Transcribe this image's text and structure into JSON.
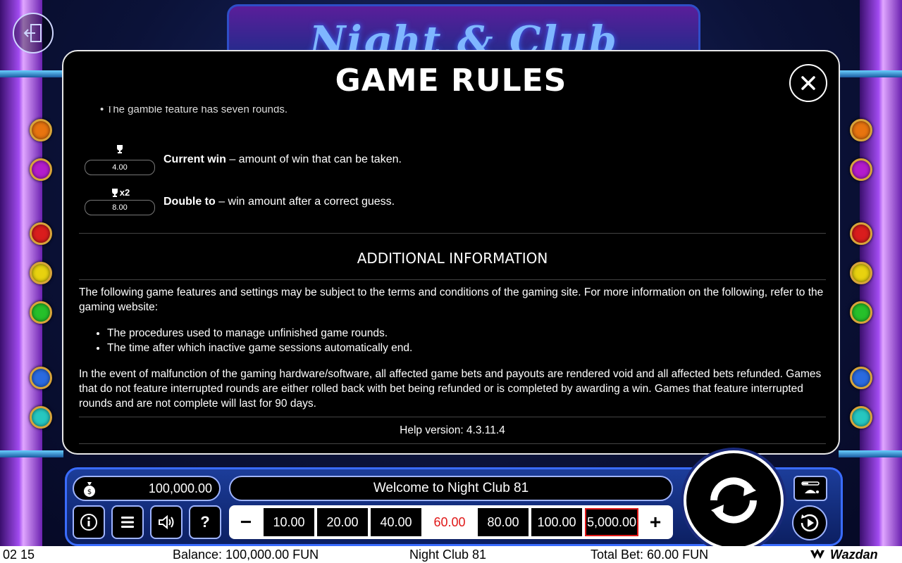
{
  "colors": {
    "accent_red": "#e01818",
    "panel_blue": "#1c3d9a",
    "marquee_text": "#7fb6ff"
  },
  "background": {
    "marquee_title": "Night & Club"
  },
  "icons": {
    "exit": "exit-door-icon",
    "close": "close-icon",
    "trophy": "trophy-icon",
    "double": "trophy-x2-icon",
    "spin": "spin-arrows-icon",
    "money_bag": "money-bag-icon"
  },
  "modal": {
    "title": "GAME RULES",
    "cut_line": "The gamble feature has seven rounds.",
    "rules": [
      {
        "pill": "4.00",
        "badge": "",
        "term": "Current win",
        "desc": " – amount of win that can be taken."
      },
      {
        "pill": "8.00",
        "badge": "x2",
        "term": "Double to",
        "desc": " – win amount after a correct guess."
      }
    ],
    "section_title": "ADDITIONAL INFORMATION",
    "intro": "The following game features and settings may be subject to the terms and conditions of the gaming site. For more information on the following, refer to the gaming website:",
    "bullets": [
      "The procedures used to manage unfinished game rounds.",
      "The time after which inactive game sessions automatically end."
    ],
    "malfunction": "In the event of malfunction of the gaming hardware/software, all affected game bets and payouts are rendered void and all affected bets refunded. Games that do not feature interrupted rounds are either rolled back with bet being refunded or is completed by awarding a win. Games that feature interrupted rounds and are not complete will last for 90 days.",
    "help_version": "Help version: 4.3.11.4"
  },
  "panel": {
    "balance": "100,000.00",
    "message": "Welcome to Night Club 81",
    "buttons": {
      "info": "i",
      "help": "?"
    },
    "bet_minus": "−",
    "bet_plus": "+",
    "bet_options": [
      "10.00",
      "20.00",
      "40.00",
      "60.00",
      "80.00",
      "100.00",
      "5,000.00"
    ],
    "selected_bet": "60.00"
  },
  "status_bar": {
    "time": "02 15",
    "balance": "Balance: 100,000.00 FUN",
    "game_name": "Night Club 81",
    "total_bet": "Total Bet: 60.00 FUN",
    "brand": "Wazdan"
  }
}
